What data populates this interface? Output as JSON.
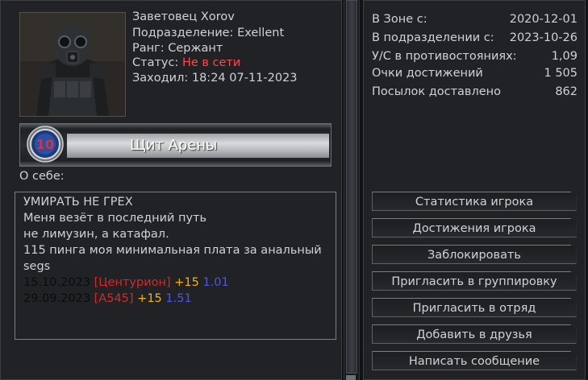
{
  "profile": {
    "name": "Заветовец Xorov",
    "unit_label": "Подразделение:",
    "unit_value": "Exellent",
    "rank_label": "Ранг:",
    "rank_value": "Сержант",
    "status_label": "Статус:",
    "status_value": "Не в сети",
    "last_seen_label": "Заходил:",
    "last_seen_value": "18:24 07-11-2023"
  },
  "rank_banner": {
    "badge_number": "10",
    "title": "Щит Арены"
  },
  "about": {
    "label": "О себе:",
    "lines": [
      "УМИРАТЬ НЕ ГРЕХ",
      "Меня везёт в последний путь",
      "не лимузин, а катафал.",
      "115 пинга моя минимальная плата за анальный",
      "segs"
    ],
    "entries": [
      {
        "date": "15.10.2023",
        "tag": "[Центурион]",
        "plus": "+15",
        "ratio": "1.01"
      },
      {
        "date": "29.09.2023",
        "tag": "[A545]",
        "plus": "+15",
        "ratio": "1.51"
      }
    ]
  },
  "stats": [
    {
      "label": "В Зоне с:",
      "value": "2020-12-01"
    },
    {
      "label": "В подразделении с:",
      "value": "2023-10-26"
    },
    {
      "label": "У/С в противостояниях:",
      "value": "1,09"
    },
    {
      "label": "Очки достижений",
      "value": "1 505"
    },
    {
      "label": "Посылок доставлено",
      "value": "862"
    }
  ],
  "actions": [
    "Статистика игрока",
    "Достижения игрока",
    "Заблокировать",
    "Пригласить в группировку",
    "Пригласить в отряд",
    "Добавить в друзья",
    "Написать сообщение"
  ],
  "colors": {
    "status_offline": "#ff4a4a",
    "entry_date": "#0c0c0c",
    "entry_tag": "#d22a2a",
    "entry_plus": "#f2b21a",
    "entry_ratio": "#4b57e6",
    "badge_number": "#e23030"
  }
}
